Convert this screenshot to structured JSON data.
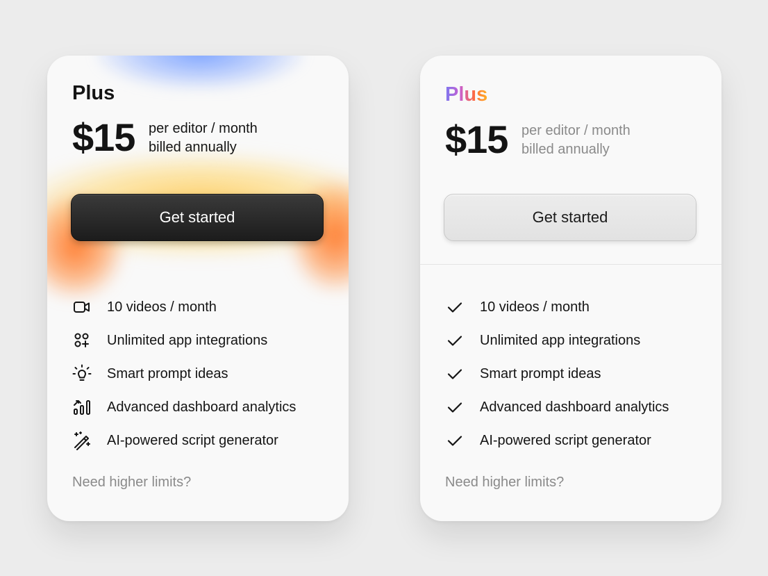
{
  "cards": [
    {
      "plan_name": "Plus",
      "price": "$15",
      "price_note_line1": "per editor / month",
      "price_note_line2": "billed annually",
      "cta_label": "Get started",
      "features": [
        {
          "icon": "video-camera-icon",
          "label": "10 videos / month"
        },
        {
          "icon": "apps-grid-icon",
          "label": "Unlimited app integrations"
        },
        {
          "icon": "lightbulb-icon",
          "label": "Smart prompt ideas"
        },
        {
          "icon": "bar-chart-icon",
          "label": "Advanced dashboard analytics"
        },
        {
          "icon": "magic-wand-icon",
          "label": "AI-powered script generator"
        }
      ],
      "limits_link": "Need higher limits?"
    },
    {
      "plan_name": "Plus",
      "price": "$15",
      "price_note_line1": "per editor / month",
      "price_note_line2": "billed annually",
      "cta_label": "Get started",
      "features": [
        {
          "icon": "check-icon",
          "label": "10 videos / month"
        },
        {
          "icon": "check-icon",
          "label": "Unlimited app integrations"
        },
        {
          "icon": "check-icon",
          "label": "Smart prompt ideas"
        },
        {
          "icon": "check-icon",
          "label": "Advanced dashboard analytics"
        },
        {
          "icon": "check-icon",
          "label": "AI-powered script generator"
        }
      ],
      "limits_link": "Need higher limits?"
    }
  ],
  "colors": {
    "background": "#ececec",
    "card": "#f9f9f9",
    "text": "#141414",
    "muted": "#8a8a8a",
    "dark_button": "#1c1c1c",
    "light_button": "#e6e6e6",
    "gradient_blue": "#7ba0ff",
    "gradient_yellow": "#ffd064",
    "gradient_orange": "#ff7a2c"
  }
}
